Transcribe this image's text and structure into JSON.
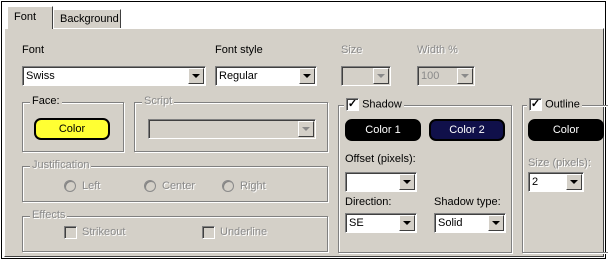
{
  "tabs": [
    {
      "label": "Font",
      "active": true
    },
    {
      "label": "Background",
      "active": false
    }
  ],
  "font": {
    "label": "Font",
    "value": "Swiss",
    "style_label": "Font style",
    "style_value": "Regular",
    "size_label": "Size",
    "size_value": "",
    "width_label": "Width %",
    "width_value": "100"
  },
  "face": {
    "legend": "Face:",
    "color_button": "Color",
    "color": "#ffff33"
  },
  "script": {
    "legend": "Script",
    "value": ""
  },
  "justification": {
    "legend": "Justification",
    "options": [
      "Left",
      "Center",
      "Right"
    ]
  },
  "effects": {
    "legend": "Effects",
    "strikeout": "Strikeout",
    "underline": "Underline"
  },
  "shadow": {
    "legend": "Shadow",
    "checked": true,
    "color1": "Color 1",
    "color2": "Color 2",
    "color1_hex": "#000000",
    "color2_hex": "#10104a",
    "offset_label": "Offset (pixels):",
    "offset_value": "",
    "direction_label": "Direction:",
    "direction_value": "SE",
    "type_label": "Shadow type:",
    "type_value": "Solid"
  },
  "outline": {
    "legend": "Outline",
    "checked": true,
    "color_button": "Color",
    "color_hex": "#000000",
    "size_label": "Size (pixels):",
    "size_value": "2"
  }
}
